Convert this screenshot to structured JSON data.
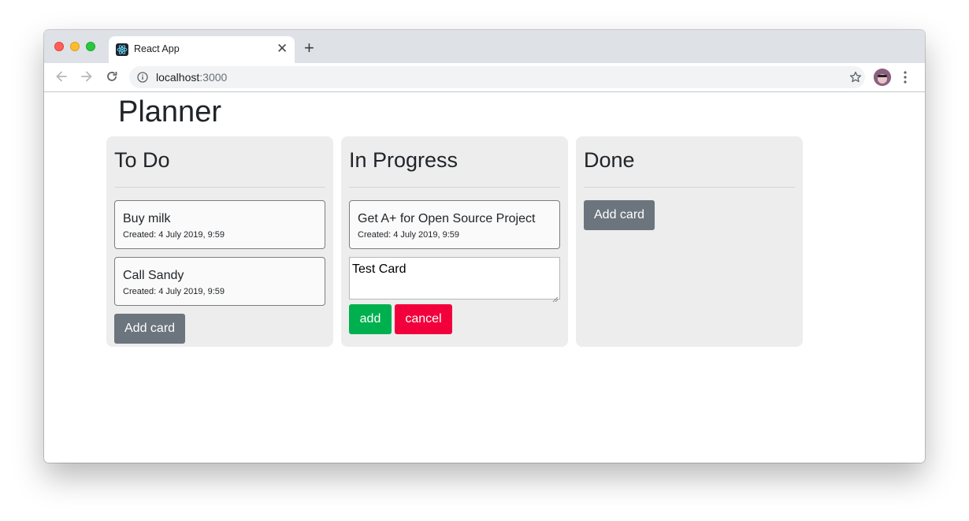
{
  "browser": {
    "tab_title": "React App",
    "url_host": "localhost",
    "url_port": ":3000"
  },
  "page": {
    "title": "Planner",
    "columns": [
      {
        "title": "To Do",
        "cards": [
          {
            "title": "Buy milk",
            "meta": "Created: 4 July 2019, 9:59"
          },
          {
            "title": "Call Sandy",
            "meta": "Created: 4 July 2019, 9:59"
          }
        ],
        "add_card_label": "Add card"
      },
      {
        "title": "In Progress",
        "cards": [
          {
            "title": "Get A+ for Open Source Project",
            "meta": "Created: 4 July 2019, 9:59"
          }
        ],
        "new_card_text": "Test Card",
        "add_label": "add",
        "cancel_label": "cancel"
      },
      {
        "title": "Done",
        "cards": [],
        "add_card_label": "Add card"
      }
    ]
  },
  "colors": {
    "column_bg": "#ededed",
    "add_card_button": "#6c757d",
    "add_button": "#00b04f",
    "cancel_button": "#f2003c"
  },
  "icons": [
    "back-arrow-icon",
    "forward-arrow-icon",
    "reload-icon",
    "info-icon",
    "star-icon",
    "kebab-menu-icon",
    "react-logo-icon",
    "close-icon",
    "plus-icon"
  ]
}
